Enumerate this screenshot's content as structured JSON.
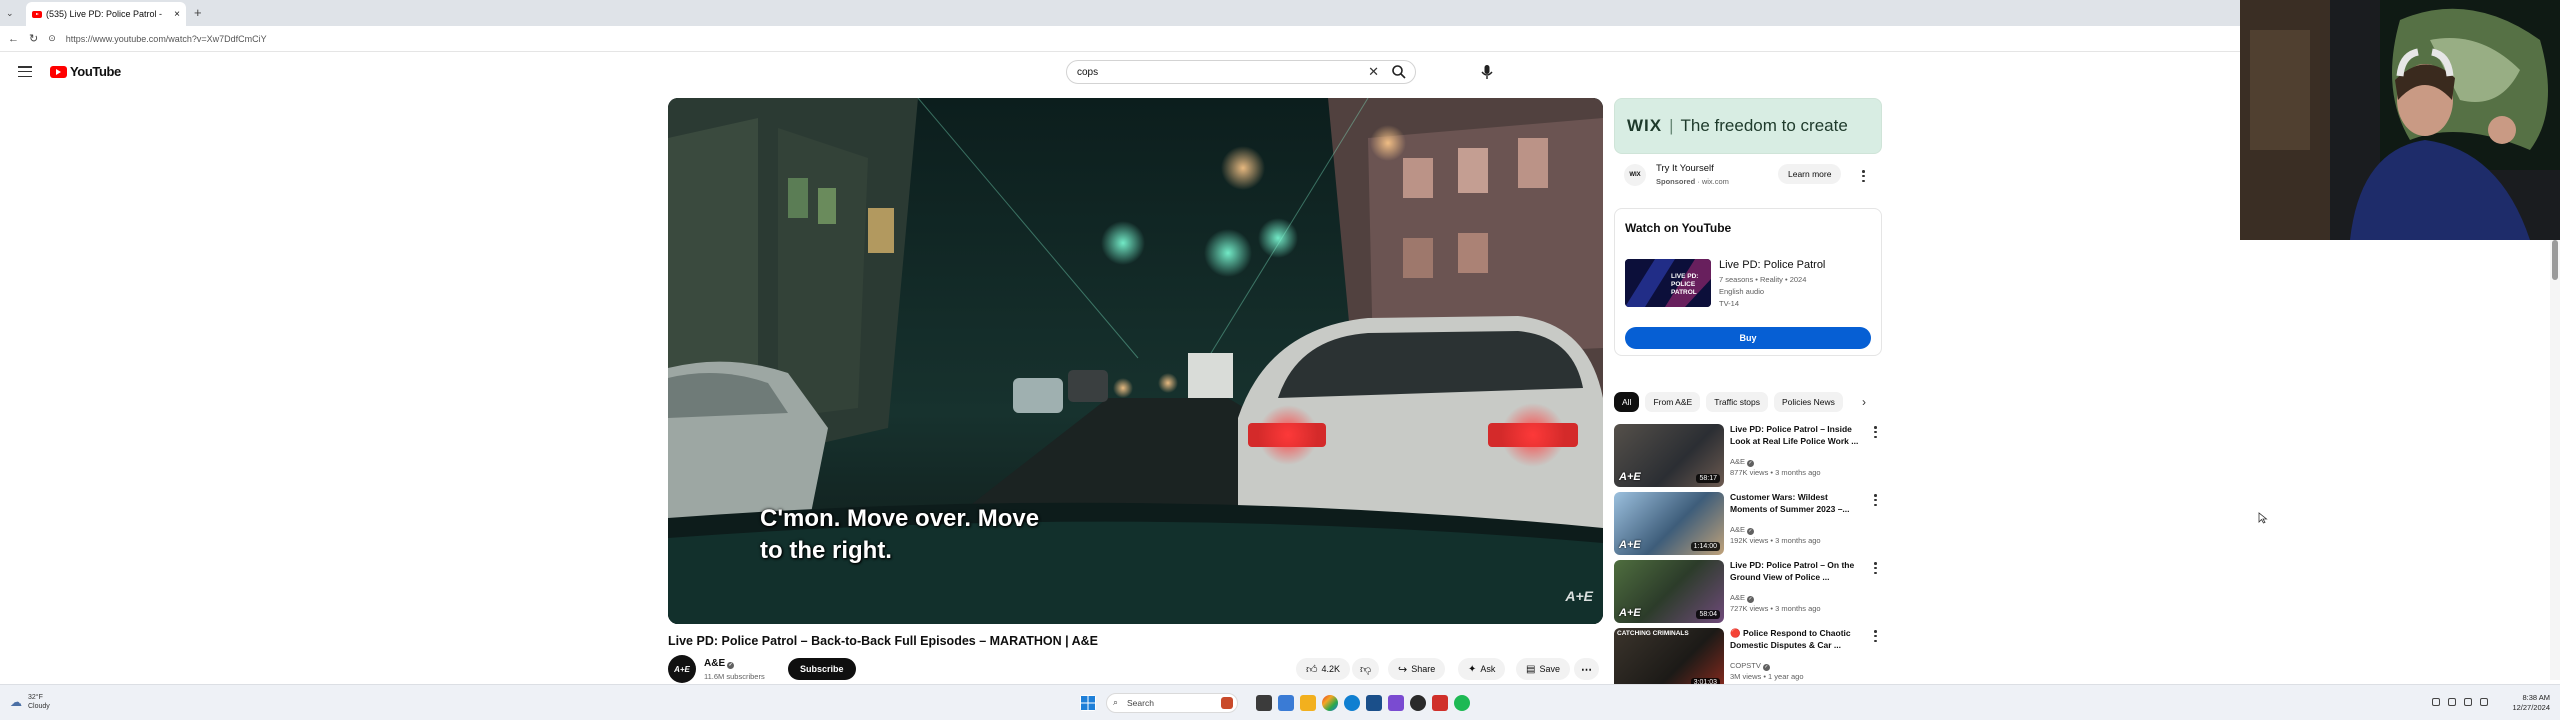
{
  "browser": {
    "tab_title": "(535) Live PD: Police Patrol -",
    "tab_close": "×",
    "new_tab": "+",
    "url": "https://www.youtube.com/watch?v=Xw7DdfCmCiY"
  },
  "youtube": {
    "logo_text": "YouTube",
    "search_value": "cops",
    "search_clear": "✕"
  },
  "video": {
    "subtitle": "C'mon. Move over. Move\nto the right.",
    "watermark": "A+E",
    "title": "Live PD: Police Patrol – Back-to-Back Full Episodes – MARATHON | A&E",
    "channel_avatar": "A+E",
    "channel_name": "A&E",
    "channel_subs": "11.6M subscribers",
    "subscribe_label": "Subscribe",
    "likes": "4.2K",
    "share_label": "Share",
    "ask_label": "Ask",
    "save_label": "Save"
  },
  "ad": {
    "banner_brand": "WIX",
    "banner_sep": "|",
    "banner_tagline": "The freedom to create",
    "icon_text": "WIX",
    "title": "Try It Yourself",
    "sponsored": "Sponsored",
    "domain": "wix.com",
    "learn_more": "Learn more"
  },
  "watch_on_youtube": {
    "heading": "Watch on YouTube",
    "thumb_text": "LIVE PD: POLICE PATROL",
    "show_title": "Live PD: Police Patrol",
    "meta1": "7 seasons • Reality • 2024",
    "meta2": "English audio",
    "meta3": "TV-14",
    "buy_label": "Buy"
  },
  "chips": [
    "All",
    "From A&E",
    "Traffic stops",
    "Policies News"
  ],
  "recommendations": [
    {
      "title": "Live PD: Police Patrol – Inside Look at Real Life Police Work ...",
      "channel": "A&E",
      "meta": "877K views • 3 months ago",
      "duration": "58:17",
      "badge": "A+E",
      "thumb_color": "#3a3d44"
    },
    {
      "title": "Customer Wars: Wildest Moments of Summer 2023 –...",
      "channel": "A&E",
      "meta": "192K views • 3 months ago",
      "duration": "1:14:00",
      "badge": "A+E",
      "thumb_color": "#4a6a86"
    },
    {
      "title": "Live PD: Police Patrol – On the Ground View of Police ...",
      "channel": "A&E",
      "meta": "727K views • 3 months ago",
      "duration": "58:04",
      "badge": "A+E",
      "thumb_color": "#3d5a3c"
    },
    {
      "title": "🔴 Police Respond to Chaotic Domestic Disputes & Car ...",
      "channel": "COPSTV",
      "meta": "3M views • 1 year ago",
      "duration": "3:01:03",
      "badge": "CATCHING CRIMINALS",
      "thumb_color": "#2c2a26"
    }
  ],
  "taskbar": {
    "temp": "32°F",
    "condition": "Cloudy",
    "search_placeholder": "Search",
    "time": "8:38 AM",
    "date": "12/27/2024"
  },
  "colors": {
    "youtube_red": "#ff0000",
    "buy_blue": "#065fd4",
    "wix_banner": "#d8ede3"
  }
}
